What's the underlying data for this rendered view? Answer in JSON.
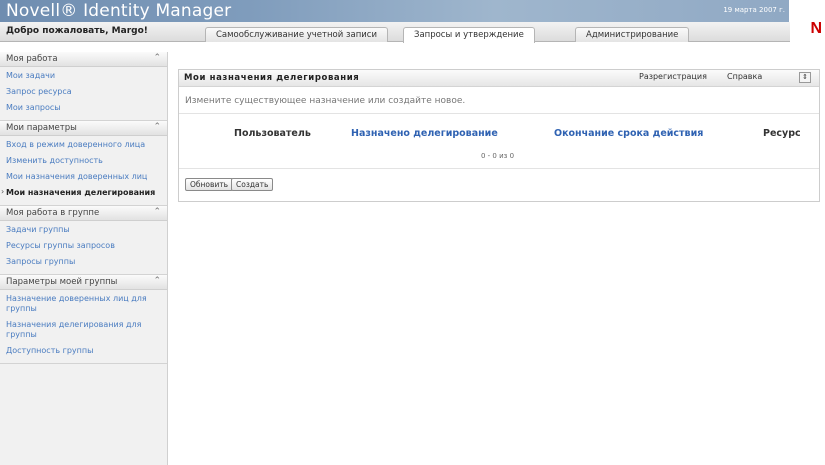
{
  "app": {
    "title": "Novell® Identity Manager",
    "date": "19 марта 2007 г."
  },
  "header": {
    "welcome": "Добро пожаловать, Margo!"
  },
  "tabs": [
    {
      "label": "Самообслуживание учетной записи",
      "active": false
    },
    {
      "label": "Запросы и утверждение",
      "active": true
    },
    {
      "label": "Администрирование",
      "active": false
    }
  ],
  "sidebar": {
    "sections": [
      {
        "title": "Моя работа",
        "items": [
          "Мои задачи",
          "Запрос ресурса",
          "Мои запросы"
        ]
      },
      {
        "title": "Мои параметры",
        "items": [
          "Вход в режим доверенного лица",
          "Изменить доступность",
          "Мои назначения доверенных лиц",
          "Мои назначения делегирования"
        ],
        "active_index": 3
      },
      {
        "title": "Моя работа в группе",
        "items": [
          "Задачи группы",
          "Ресурсы группы запросов",
          "Запросы группы"
        ]
      },
      {
        "title": "Параметры моей группы",
        "items": [
          "Назначение доверенных лиц для группы",
          "Назначения делегирования для группы",
          "Доступность группы"
        ]
      }
    ]
  },
  "panel": {
    "title": "Мои назначения делегирования",
    "logout": "Разрегистрация",
    "help": "Справка",
    "description": "Измените существующее назначение или создайте новое.",
    "columns": [
      "Пользователь",
      "Назначено делегирование",
      "Окончание срока действия",
      "Ресурс"
    ],
    "pager": "0 - 0 из 0",
    "buttons": {
      "refresh": "Обновить",
      "create": "Создать"
    }
  },
  "colors": {
    "header": "#7f9cbc",
    "link": "#4a7cc0",
    "sort_header": "#2f62b2",
    "logo": "#cc0000"
  },
  "icons": {
    "collapse": "chevron-up-icon",
    "panel_toggle": "expand-icon"
  }
}
